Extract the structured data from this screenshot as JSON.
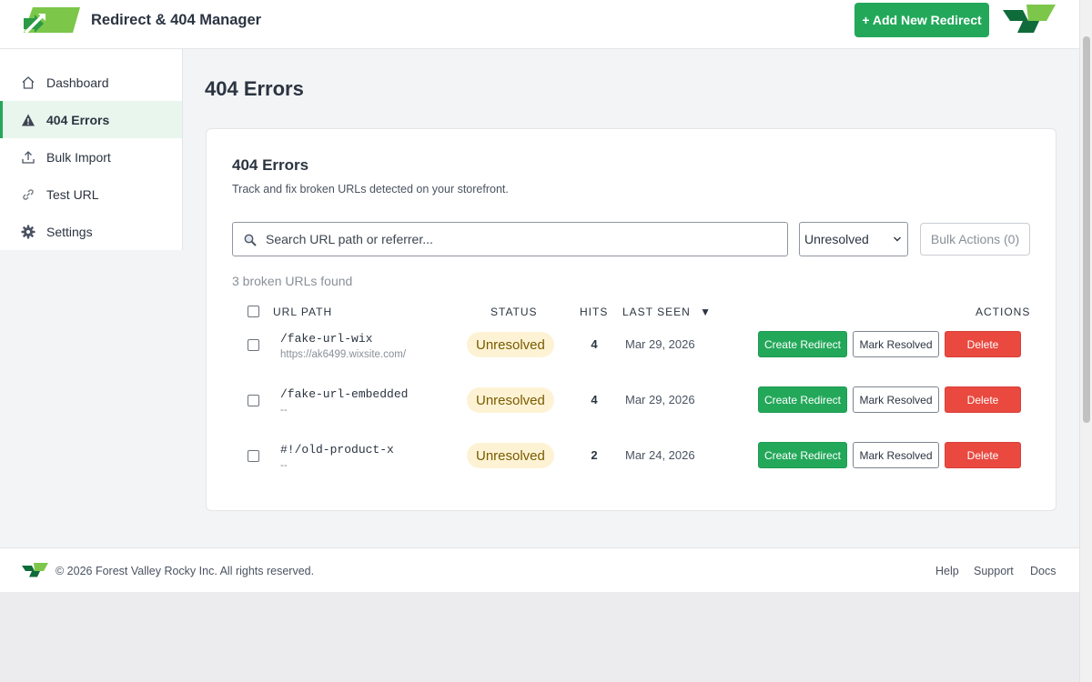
{
  "header": {
    "title": "Redirect & 404 Manager",
    "add_button": "+ Add New Redirect"
  },
  "sidebar": {
    "items": [
      {
        "label": "Dashboard",
        "icon": "home-icon",
        "active": false
      },
      {
        "label": "404 Errors",
        "icon": "warning-icon",
        "active": true
      },
      {
        "label": "Bulk Import",
        "icon": "upload-icon",
        "active": false
      },
      {
        "label": "Test URL",
        "icon": "link-icon",
        "active": false
      },
      {
        "label": "Settings",
        "icon": "gear-icon",
        "active": false
      }
    ]
  },
  "page": {
    "title": "404 Errors"
  },
  "card": {
    "title": "404 Errors",
    "subtitle": "Track and fix broken URLs detected on your storefront.",
    "search_placeholder": "Search URL path or referrer...",
    "filter_value": "Unresolved",
    "bulk_button": "Bulk Actions (0)",
    "count_text": "3 broken URLs found"
  },
  "table": {
    "headers": {
      "url_path": "URL PATH",
      "status": "STATUS",
      "hits": "HITS",
      "last_seen": "LAST SEEN",
      "sort_indicator": "▼",
      "actions": "ACTIONS"
    },
    "rows": [
      {
        "path": "/fake-url-wix",
        "referrer": "https://ak6499.wixsite.com/",
        "status": "Unresolved",
        "hits": "4",
        "last_seen": "Mar 29, 2026"
      },
      {
        "path": "/fake-url-embedded",
        "referrer": "--",
        "status": "Unresolved",
        "hits": "4",
        "last_seen": "Mar 29, 2026"
      },
      {
        "path": "#!/old-product-x",
        "referrer": "--",
        "status": "Unresolved",
        "hits": "2",
        "last_seen": "Mar 24, 2026"
      }
    ],
    "actions": {
      "create": "Create Redirect",
      "resolve": "Mark Resolved",
      "delete": "Delete"
    }
  },
  "footer": {
    "copyright": "© 2026 Forest Valley Rocky Inc. All rights reserved.",
    "links": [
      "Help",
      "Support",
      "Docs"
    ]
  },
  "colors": {
    "accent": "#23a85a",
    "danger": "#e9493f",
    "badge_bg": "#fdf3d4",
    "badge_text": "#7a5a00",
    "logo_light": "#7cc74a",
    "logo_dark": "#0f6b3a"
  }
}
